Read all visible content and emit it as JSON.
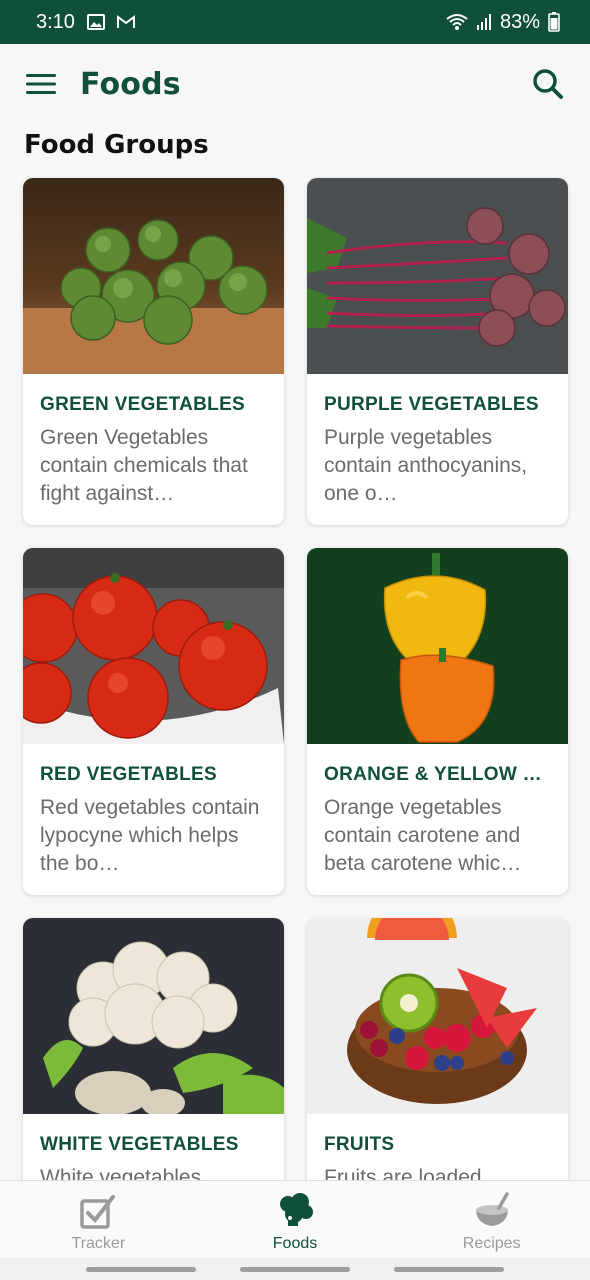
{
  "status_bar": {
    "time": "3:10",
    "battery": "83%"
  },
  "app_bar": {
    "title": "Foods",
    "menu_icon": "hamburger-menu-icon",
    "search_icon": "search-icon"
  },
  "section": {
    "title": "Food Groups"
  },
  "cards": [
    {
      "title": "GREEN VEGETABLES",
      "desc": "Green Vegetables contain chemicals that fight against…",
      "image": "brussels-sprouts-image"
    },
    {
      "title": "PURPLE VEGETABLES",
      "desc": "Purple vegetables contain anthocyanins, one o…",
      "image": "beets-image"
    },
    {
      "title": "RED VEGETABLES",
      "desc": "Red vegetables contain lypocyne which helps the bo…",
      "image": "tomatoes-image"
    },
    {
      "title": "ORANGE & YELLOW …",
      "desc": "Orange vegetables contain carotene and beta carotene whic…",
      "image": "bell-peppers-image"
    },
    {
      "title": "WHITE VEGETABLES",
      "desc": "White vegetables",
      "image": "cauliflower-image"
    },
    {
      "title": "FRUITS",
      "desc": "Fruits are loaded",
      "image": "fruit-bowl-image"
    }
  ],
  "bottom_nav": [
    {
      "label": "Tracker",
      "icon": "checkbox-icon",
      "active": false
    },
    {
      "label": "Foods",
      "icon": "broccoli-icon",
      "active": true
    },
    {
      "label": "Recipes",
      "icon": "bowl-icon",
      "active": false
    }
  ],
  "colors": {
    "brand": "#0f4f3c",
    "text_muted": "#6b6b6b",
    "nav_inactive": "#9a9a9a"
  }
}
